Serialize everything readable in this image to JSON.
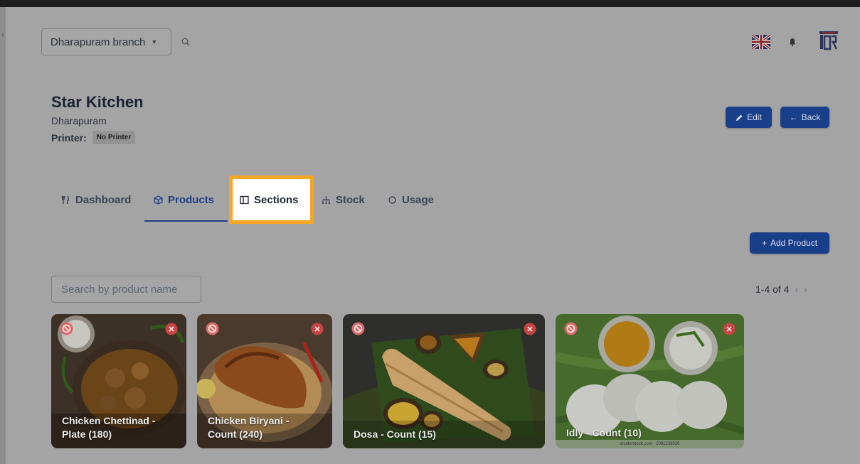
{
  "header": {
    "branch_select": "Dharapuram branch",
    "language_flag": "uk-flag-icon",
    "icons": [
      "search-icon",
      "bell-icon",
      "logo-icon"
    ]
  },
  "kitchen": {
    "title": "Star Kitchen",
    "location": "Dharapuram",
    "printer_label": "Printer:",
    "printer_value": "No Printer"
  },
  "actions": {
    "edit": "Edit",
    "back": "Back",
    "add_product": "Add Product"
  },
  "tabs": [
    {
      "label": "Dashboard",
      "icon": "fork-knife-icon"
    },
    {
      "label": "Products",
      "icon": "box-icon",
      "active": true
    },
    {
      "label": "Sections",
      "icon": "sidebar-icon",
      "highlighted": true
    },
    {
      "label": "Stock",
      "icon": "hierarchy-icon"
    },
    {
      "label": "Usage",
      "icon": "circle-icon"
    }
  ],
  "search": {
    "placeholder": "Search by product name"
  },
  "pagination": {
    "range": "1-4 of 4"
  },
  "products": [
    {
      "line1": "Chicken Chettinad -",
      "line2": "Plate (180)"
    },
    {
      "line1": "Chicken Biryani -",
      "line2": "Count (240)"
    },
    {
      "line1": "Dosa - Count (15)",
      "line2": ""
    },
    {
      "line1": "Idly - Count (10)",
      "line2": "",
      "watermark": "shutterstock.com · 2091238026"
    }
  ],
  "colors": {
    "primary": "#1a3f8a",
    "highlight": "#f5a623",
    "overlay": "#a4a4a4"
  }
}
